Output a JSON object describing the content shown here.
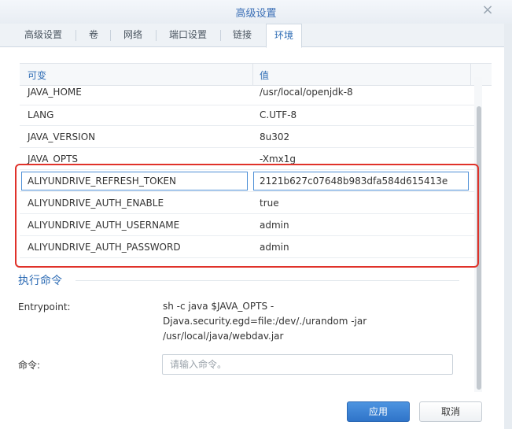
{
  "window": {
    "title": "高级设置",
    "close_glyph": "×"
  },
  "tabs": [
    {
      "label": "高级设置"
    },
    {
      "label": "卷"
    },
    {
      "label": "网络"
    },
    {
      "label": "端口设置"
    },
    {
      "label": "链接"
    },
    {
      "label": "环境",
      "active": true
    }
  ],
  "env_table": {
    "columns": [
      "可变",
      "值"
    ],
    "rows": [
      {
        "name": "JAVA_HOME",
        "value": "/usr/local/openjdk-8"
      },
      {
        "name": "LANG",
        "value": "C.UTF-8"
      },
      {
        "name": "JAVA_VERSION",
        "value": "8u302"
      },
      {
        "name": "JAVA_OPTS",
        "value": "-Xmx1g"
      },
      {
        "name": "ALIYUNDRIVE_REFRESH_TOKEN",
        "value": "2121b627c07648b983dfa584d615413e",
        "editing": true
      },
      {
        "name": "ALIYUNDRIVE_AUTH_ENABLE",
        "value": "true"
      },
      {
        "name": "ALIYUNDRIVE_AUTH_USERNAME",
        "value": "admin"
      },
      {
        "name": "ALIYUNDRIVE_AUTH_PASSWORD",
        "value": "admin"
      }
    ]
  },
  "exec_section": {
    "title": "执行命令",
    "entrypoint_label": "Entrypoint:",
    "entrypoint_lines": [
      "sh -c java $JAVA_OPTS -",
      "Djava.security.egd=file:/dev/./urandom -jar",
      "/usr/local/java/webdav.jar"
    ],
    "command_label": "命令:",
    "command_placeholder": "请输入命令。",
    "command_value": ""
  },
  "footer": {
    "apply_label": "应用",
    "cancel_label": "取消"
  },
  "colors": {
    "accent": "#2f6db5",
    "highlight_border": "#e0322a",
    "apply_button": "#3a82d4"
  }
}
